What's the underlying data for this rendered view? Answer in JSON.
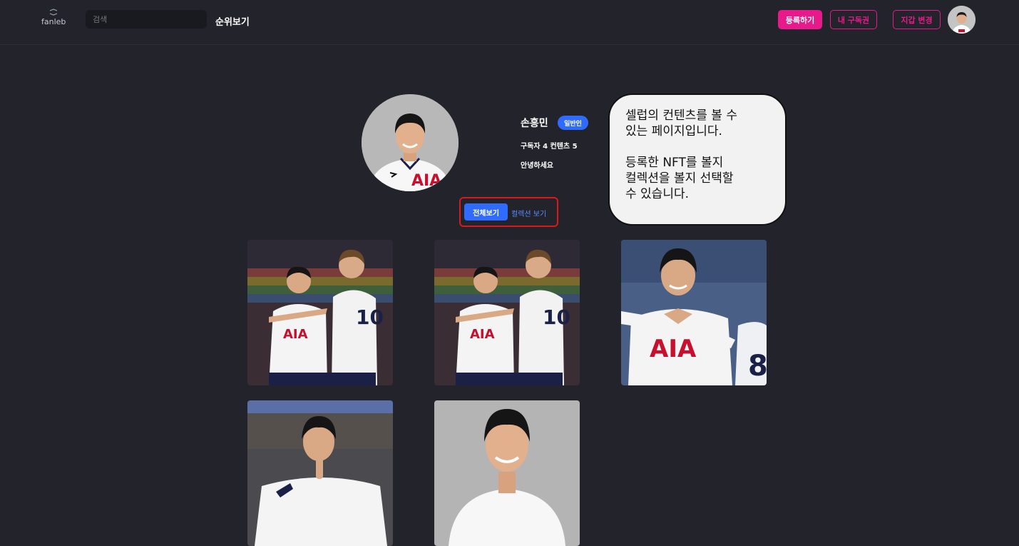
{
  "header": {
    "logo_text": "fanleb",
    "search_placeholder": "검색",
    "rank_label": "순위보기",
    "register_label": "등록하기",
    "subscriptions_label": "내 구독권",
    "wallet_label": "지갑 변경"
  },
  "profile": {
    "name": "손흥민",
    "badge": "일반인",
    "subscribers_label": "구독자 4",
    "contents_label": "컨텐츠 5",
    "bio": "안녕하세요"
  },
  "tabs": {
    "all_label": "전체보기",
    "collection_label": "컬렉션 보기"
  },
  "callout": {
    "text": "셀럽의 컨텐츠를 볼 수\n있는 페이지입니다.\n\n등록한 NFT를 볼지\n컬렉션을 볼지 선택할\n수 있습니다."
  },
  "colors": {
    "background": "#23232b",
    "accent_pink": "#e8198b",
    "accent_blue": "#2f6bff",
    "highlight_red": "#d81a1a"
  },
  "content_cards": [
    {
      "icon": "celebration-photo"
    },
    {
      "icon": "celebration-photo"
    },
    {
      "icon": "gesture-photo"
    },
    {
      "icon": "shush-photo"
    },
    {
      "icon": "portrait-photo"
    }
  ]
}
